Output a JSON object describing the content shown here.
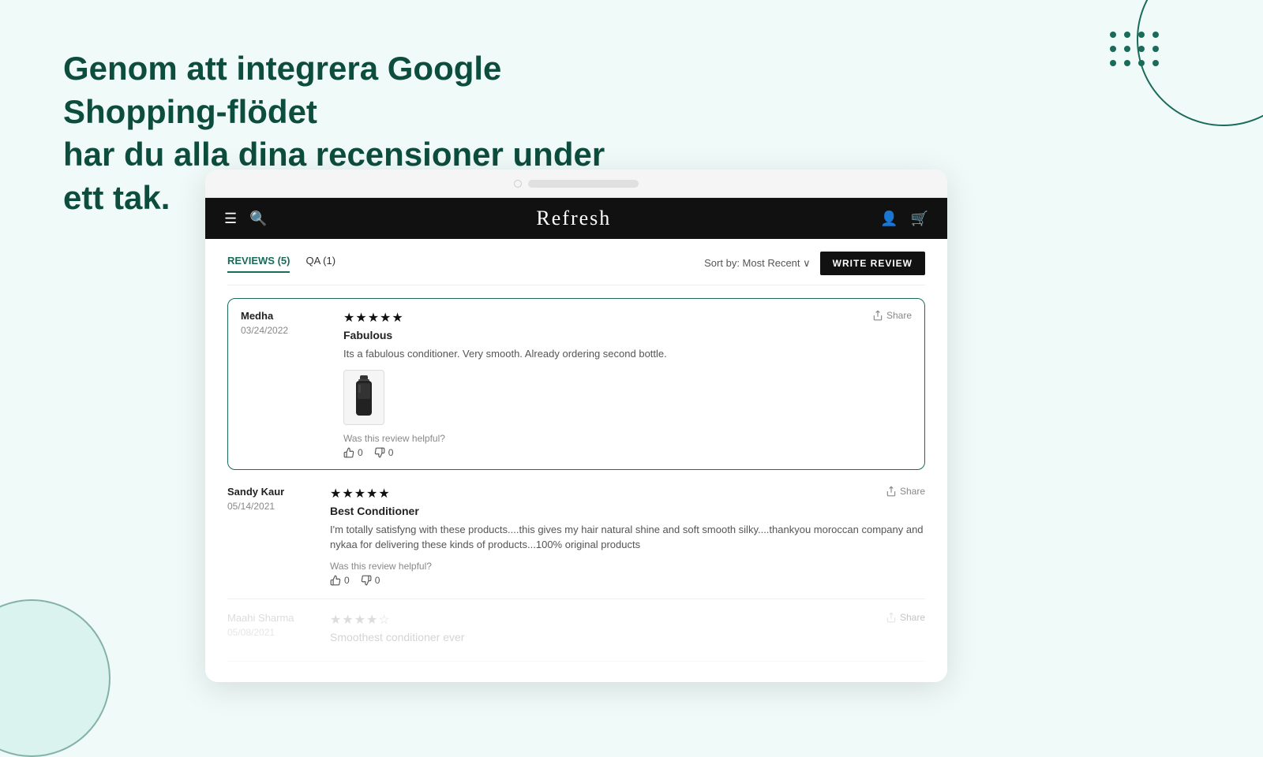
{
  "hero": {
    "title_line1": "Genom att integrera Google Shopping-flödet",
    "title_line2": "har du alla dina recensioner under ett tak."
  },
  "app": {
    "title": "Refresh"
  },
  "tabs": [
    {
      "label": "REVIEWS (5)",
      "active": true
    },
    {
      "label": "QA (1)",
      "active": false
    }
  ],
  "sort": {
    "label": "Sort by: Most Recent ∨"
  },
  "write_review_btn": "WRITE REVIEW",
  "reviews": [
    {
      "name": "Medha",
      "date": "03/24/2022",
      "stars": "★★★★★",
      "title": "Fabulous",
      "body": "Its a fabulous conditioner. Very smooth. Already ordering second bottle.",
      "has_image": true,
      "helpful_text": "Was this review helpful?",
      "thumbs_up": "0",
      "thumbs_down": "0",
      "share": "Share",
      "highlighted": true,
      "faded": false
    },
    {
      "name": "Sandy Kaur",
      "date": "05/14/2021",
      "stars": "★★★★★",
      "title": "Best Conditioner",
      "body": "I'm totally satisfyng with these products....this gives my hair natural shine and soft smooth silky....thankyou moroccan company and nykaa for delivering these kinds of products...100% original products",
      "has_image": false,
      "helpful_text": "Was this review helpful?",
      "thumbs_up": "0",
      "thumbs_down": "0",
      "share": "Share",
      "highlighted": false,
      "faded": false
    },
    {
      "name": "Maahi Sharma",
      "date": "05/08/2021",
      "stars": "★★★★☆",
      "title": "Smoothest conditioner ever",
      "body": "",
      "has_image": false,
      "helpful_text": "",
      "thumbs_up": "",
      "thumbs_down": "",
      "share": "Share",
      "highlighted": false,
      "faded": true
    }
  ]
}
